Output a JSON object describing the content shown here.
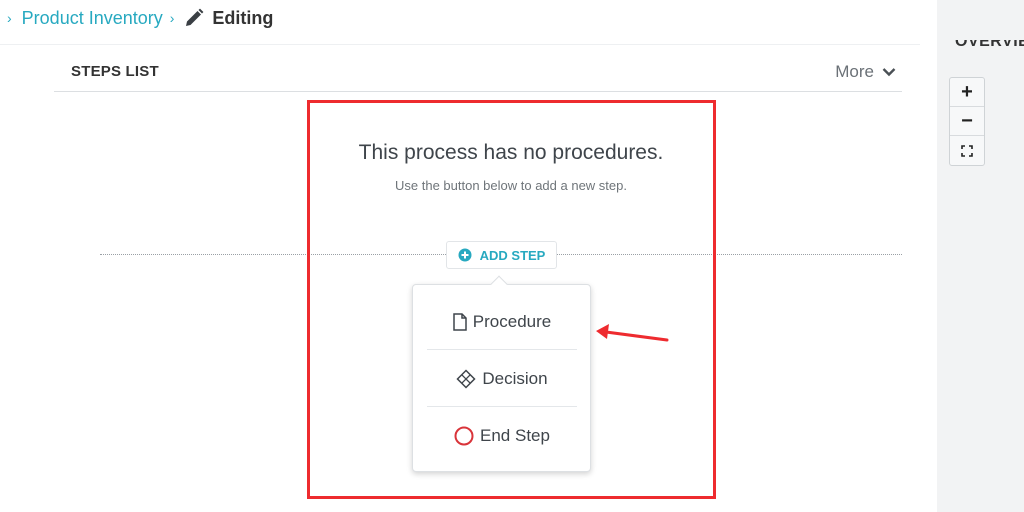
{
  "breadcrumb": {
    "separator": "›",
    "parent": "Product Inventory",
    "current": "Editing"
  },
  "steps_list": {
    "title": "STEPS LIST",
    "more_label": "More"
  },
  "empty_state": {
    "title": "This process has no procedures.",
    "subtitle": "Use the button below to add a new step."
  },
  "add_step": {
    "label": "ADD STEP",
    "icon": "plus-circle-icon"
  },
  "menu": {
    "items": [
      {
        "label": "Procedure",
        "icon": "document-icon"
      },
      {
        "label": "Decision",
        "icon": "diamond-icon"
      },
      {
        "label": "End Step",
        "icon": "circle-icon"
      }
    ]
  },
  "overview": {
    "title": "OVERVIEW",
    "zoom_in": "+",
    "zoom_out": "−"
  },
  "colors": {
    "accent": "#27a9c0",
    "annotation": "#ee2b2f",
    "end_step": "#d9343a"
  }
}
